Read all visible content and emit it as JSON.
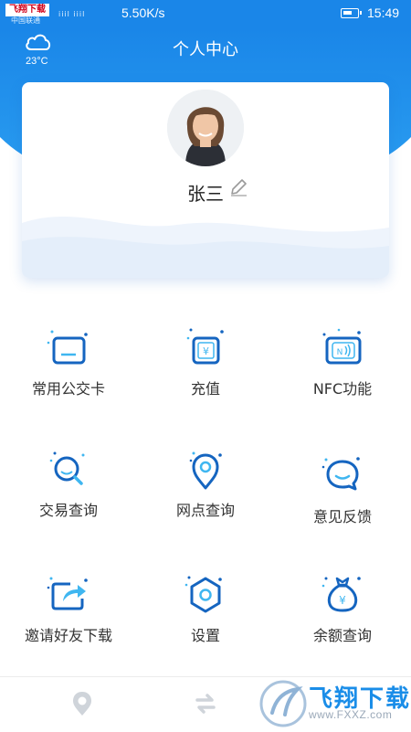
{
  "status_bar": {
    "watermark_badge": "飞翔下载",
    "carrier": "中国联通",
    "signal": "iiil  iiil",
    "speed": "5.50K/s",
    "time": "15:49"
  },
  "header": {
    "title": "个人中心",
    "weather": {
      "icon": "cloud-icon",
      "temperature": "23°C"
    }
  },
  "profile": {
    "name": "张三",
    "avatar_icon": "avatar-photo",
    "edit_icon": "pencil-icon"
  },
  "menu": {
    "items": [
      {
        "label": "常用公交卡",
        "icon": "bus-card-icon"
      },
      {
        "label": "充值",
        "icon": "recharge-icon"
      },
      {
        "label": "NFC功能",
        "icon": "nfc-icon"
      },
      {
        "label": "交易查询",
        "icon": "transaction-search-icon"
      },
      {
        "label": "网点查询",
        "icon": "location-icon"
      },
      {
        "label": "意见反馈",
        "icon": "feedback-icon"
      },
      {
        "label": "邀请好友下载",
        "icon": "share-icon"
      },
      {
        "label": "设置",
        "icon": "settings-icon"
      },
      {
        "label": "余额查询",
        "icon": "balance-bag-icon"
      }
    ]
  },
  "bottom_nav": {
    "items": [
      {
        "icon": "map-pin-icon"
      },
      {
        "icon": "swap-icon"
      }
    ]
  },
  "watermark": {
    "brand": "飞翔下载",
    "site": "www.FXXZ.com"
  },
  "colors": {
    "primary": "#1a86e8",
    "icon_dark": "#1565c0",
    "icon_accent": "#3fb6f0",
    "text": "#333333"
  }
}
